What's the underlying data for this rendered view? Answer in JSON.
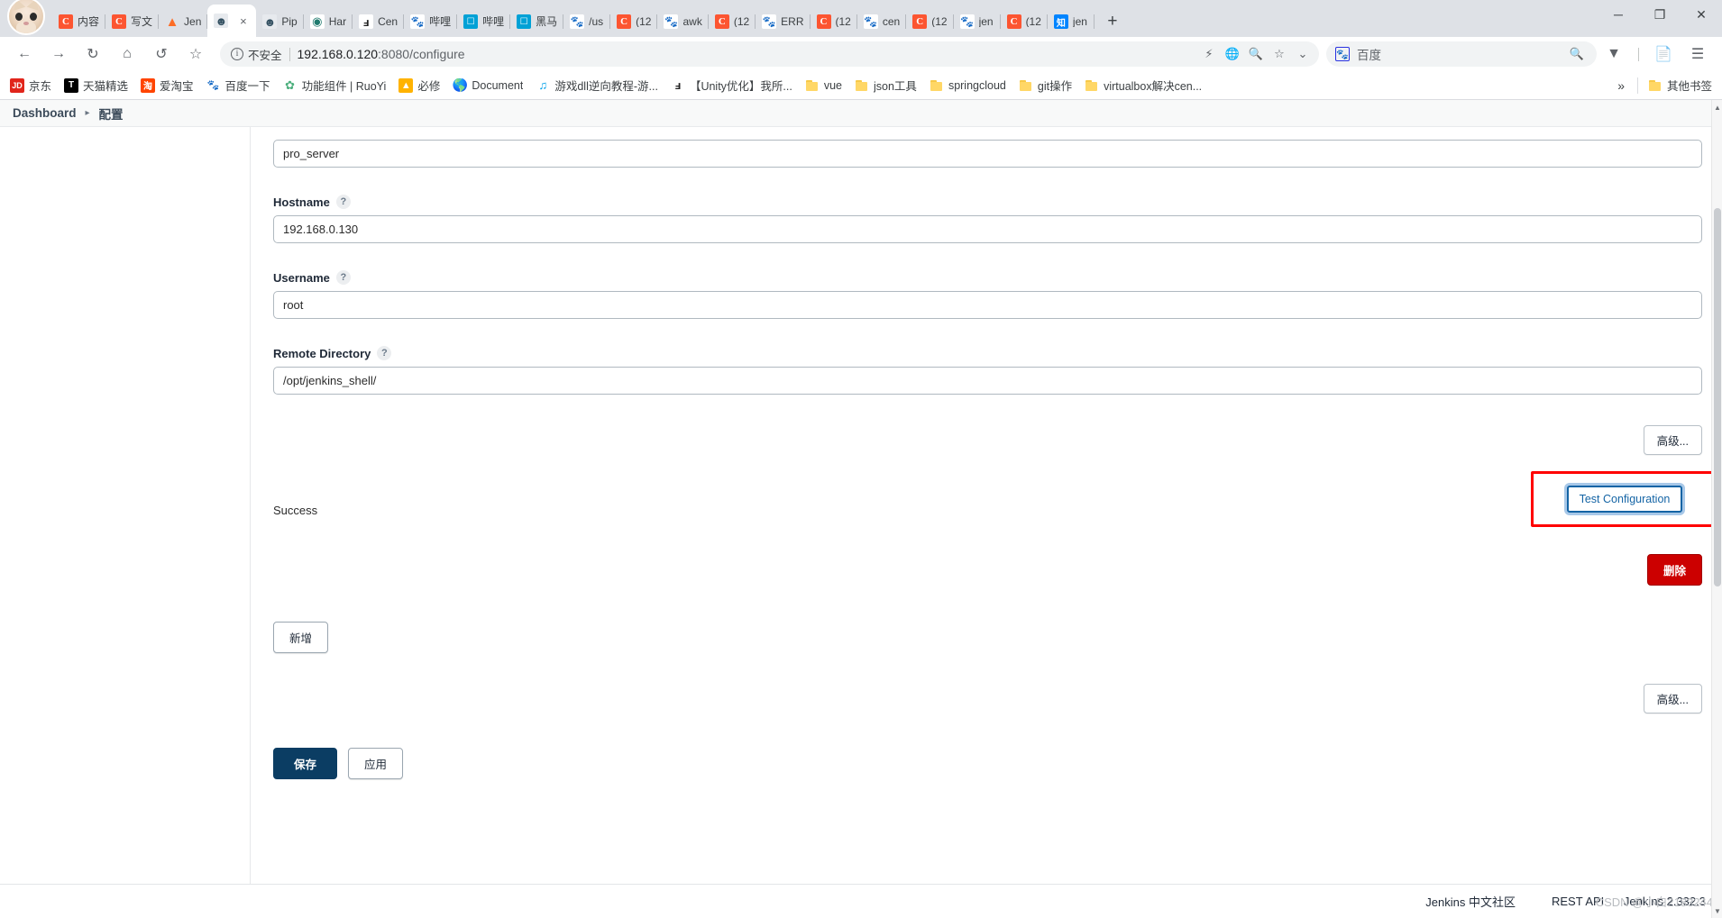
{
  "browser": {
    "tabs": [
      {
        "title": "内容",
        "icon": "csdn-icon",
        "active": false
      },
      {
        "title": "写文",
        "icon": "csdn-icon",
        "active": false
      },
      {
        "title": "Jen",
        "icon": "gitlab-icon",
        "active": false
      },
      {
        "title": "",
        "icon": "jenkins-icon",
        "active": true
      },
      {
        "title": "Pip",
        "icon": "jenkins-icon",
        "active": false
      },
      {
        "title": "Har",
        "icon": "harmony-icon",
        "active": false
      },
      {
        "title": "Cen",
        "icon": "cen-icon",
        "active": false
      },
      {
        "title": "哔哩",
        "icon": "baidu-icon",
        "active": false
      },
      {
        "title": "哔哩",
        "icon": "bilibili-icon",
        "active": false
      },
      {
        "title": "黑马",
        "icon": "bilibili-icon",
        "active": false
      },
      {
        "title": "/us",
        "icon": "baidu-icon",
        "active": false
      },
      {
        "title": "(12",
        "icon": "csdn-icon",
        "active": false
      },
      {
        "title": "awk",
        "icon": "baidu-icon",
        "active": false
      },
      {
        "title": "(12",
        "icon": "csdn-icon",
        "active": false
      },
      {
        "title": "ERR",
        "icon": "baidu-icon",
        "active": false
      },
      {
        "title": "(12",
        "icon": "csdn-icon",
        "active": false
      },
      {
        "title": "cen",
        "icon": "baidu-icon",
        "active": false
      },
      {
        "title": "(12",
        "icon": "csdn-icon",
        "active": false
      },
      {
        "title": "jen",
        "icon": "baidu-icon",
        "active": false
      },
      {
        "title": "(12",
        "icon": "csdn-icon",
        "active": false
      },
      {
        "title": "jen",
        "icon": "zhihu-icon",
        "active": false
      }
    ],
    "tab_close_label": "×",
    "new_tab_label": "+",
    "window_controls": {
      "minimize": "─",
      "maximize": "❐",
      "close": "✕"
    },
    "nav": {
      "back": "←",
      "forward": "→",
      "reload": "↻",
      "home": "⌂",
      "history_back": "↺",
      "bookmark_star": "☆"
    },
    "omnibox": {
      "security_icon": "info-icon",
      "security_label": "不安全",
      "url_host": "192.168.0.120",
      "url_rest": ":8080/configure",
      "actions": [
        "flash-icon",
        "translate-icon",
        "zoom-out-icon",
        "bookmark-star-icon",
        "chevron-down-icon"
      ]
    },
    "search": {
      "engine": "baidu-icon",
      "placeholder": "百度",
      "submit_icon": "search-icon"
    },
    "toolbar_right": [
      "vpn-icon",
      "pdf-icon",
      "menu-icon"
    ],
    "bookmarks": [
      {
        "label": "京东",
        "icon": "jd-icon"
      },
      {
        "label": "天猫精选",
        "icon": "tmall-icon"
      },
      {
        "label": "爱淘宝",
        "icon": "taobao-icon"
      },
      {
        "label": "百度一下",
        "icon": "baidu-icon"
      },
      {
        "label": "功能组件 | RuoYi",
        "icon": "ruoyi-icon"
      },
      {
        "label": "必修",
        "icon": "bixiu-icon"
      },
      {
        "label": "Document",
        "icon": "document-icon"
      },
      {
        "label": "游戏dll逆向教程-游...",
        "icon": "youku-icon"
      },
      {
        "label": "【Unity优化】我所...",
        "icon": "unity-icon"
      },
      {
        "label": "vue",
        "icon": "folder-icon"
      },
      {
        "label": "json工具",
        "icon": "folder-icon"
      },
      {
        "label": "springcloud",
        "icon": "folder-icon"
      },
      {
        "label": "git操作",
        "icon": "folder-icon"
      },
      {
        "label": "virtualbox解决cen...",
        "icon": "folder-icon"
      }
    ],
    "bookmarks_overflow_label": "»",
    "other_bookmarks": {
      "label": "其他书签",
      "icon": "folder-icon"
    }
  },
  "page": {
    "breadcrumb": {
      "root": "Dashboard",
      "separator": "▸",
      "current": "配置"
    },
    "fields": [
      {
        "name": "name",
        "label": "",
        "value": "pro_server",
        "help": "?",
        "show_label": false
      },
      {
        "name": "hostname",
        "label": "Hostname",
        "value": "192.168.0.130",
        "help": "?",
        "show_label": true
      },
      {
        "name": "username",
        "label": "Username",
        "value": "root",
        "help": "?",
        "show_label": true
      },
      {
        "name": "remote_directory",
        "label": "Remote Directory",
        "value": "/opt/jenkins_shell/",
        "help": "?",
        "show_label": true
      }
    ],
    "buttons": {
      "advanced_1": "高级...",
      "test_configuration": "Test Configuration",
      "delete": "删除",
      "add": "新增",
      "advanced_2": "高级...",
      "save": "保存",
      "apply": "应用"
    },
    "status_message": "Success",
    "footer": {
      "community": "Jenkins 中文社区",
      "rest_api": "REST API",
      "version": "Jenkins 2.332.3",
      "watermark": "CSDN @小白2183244"
    }
  }
}
